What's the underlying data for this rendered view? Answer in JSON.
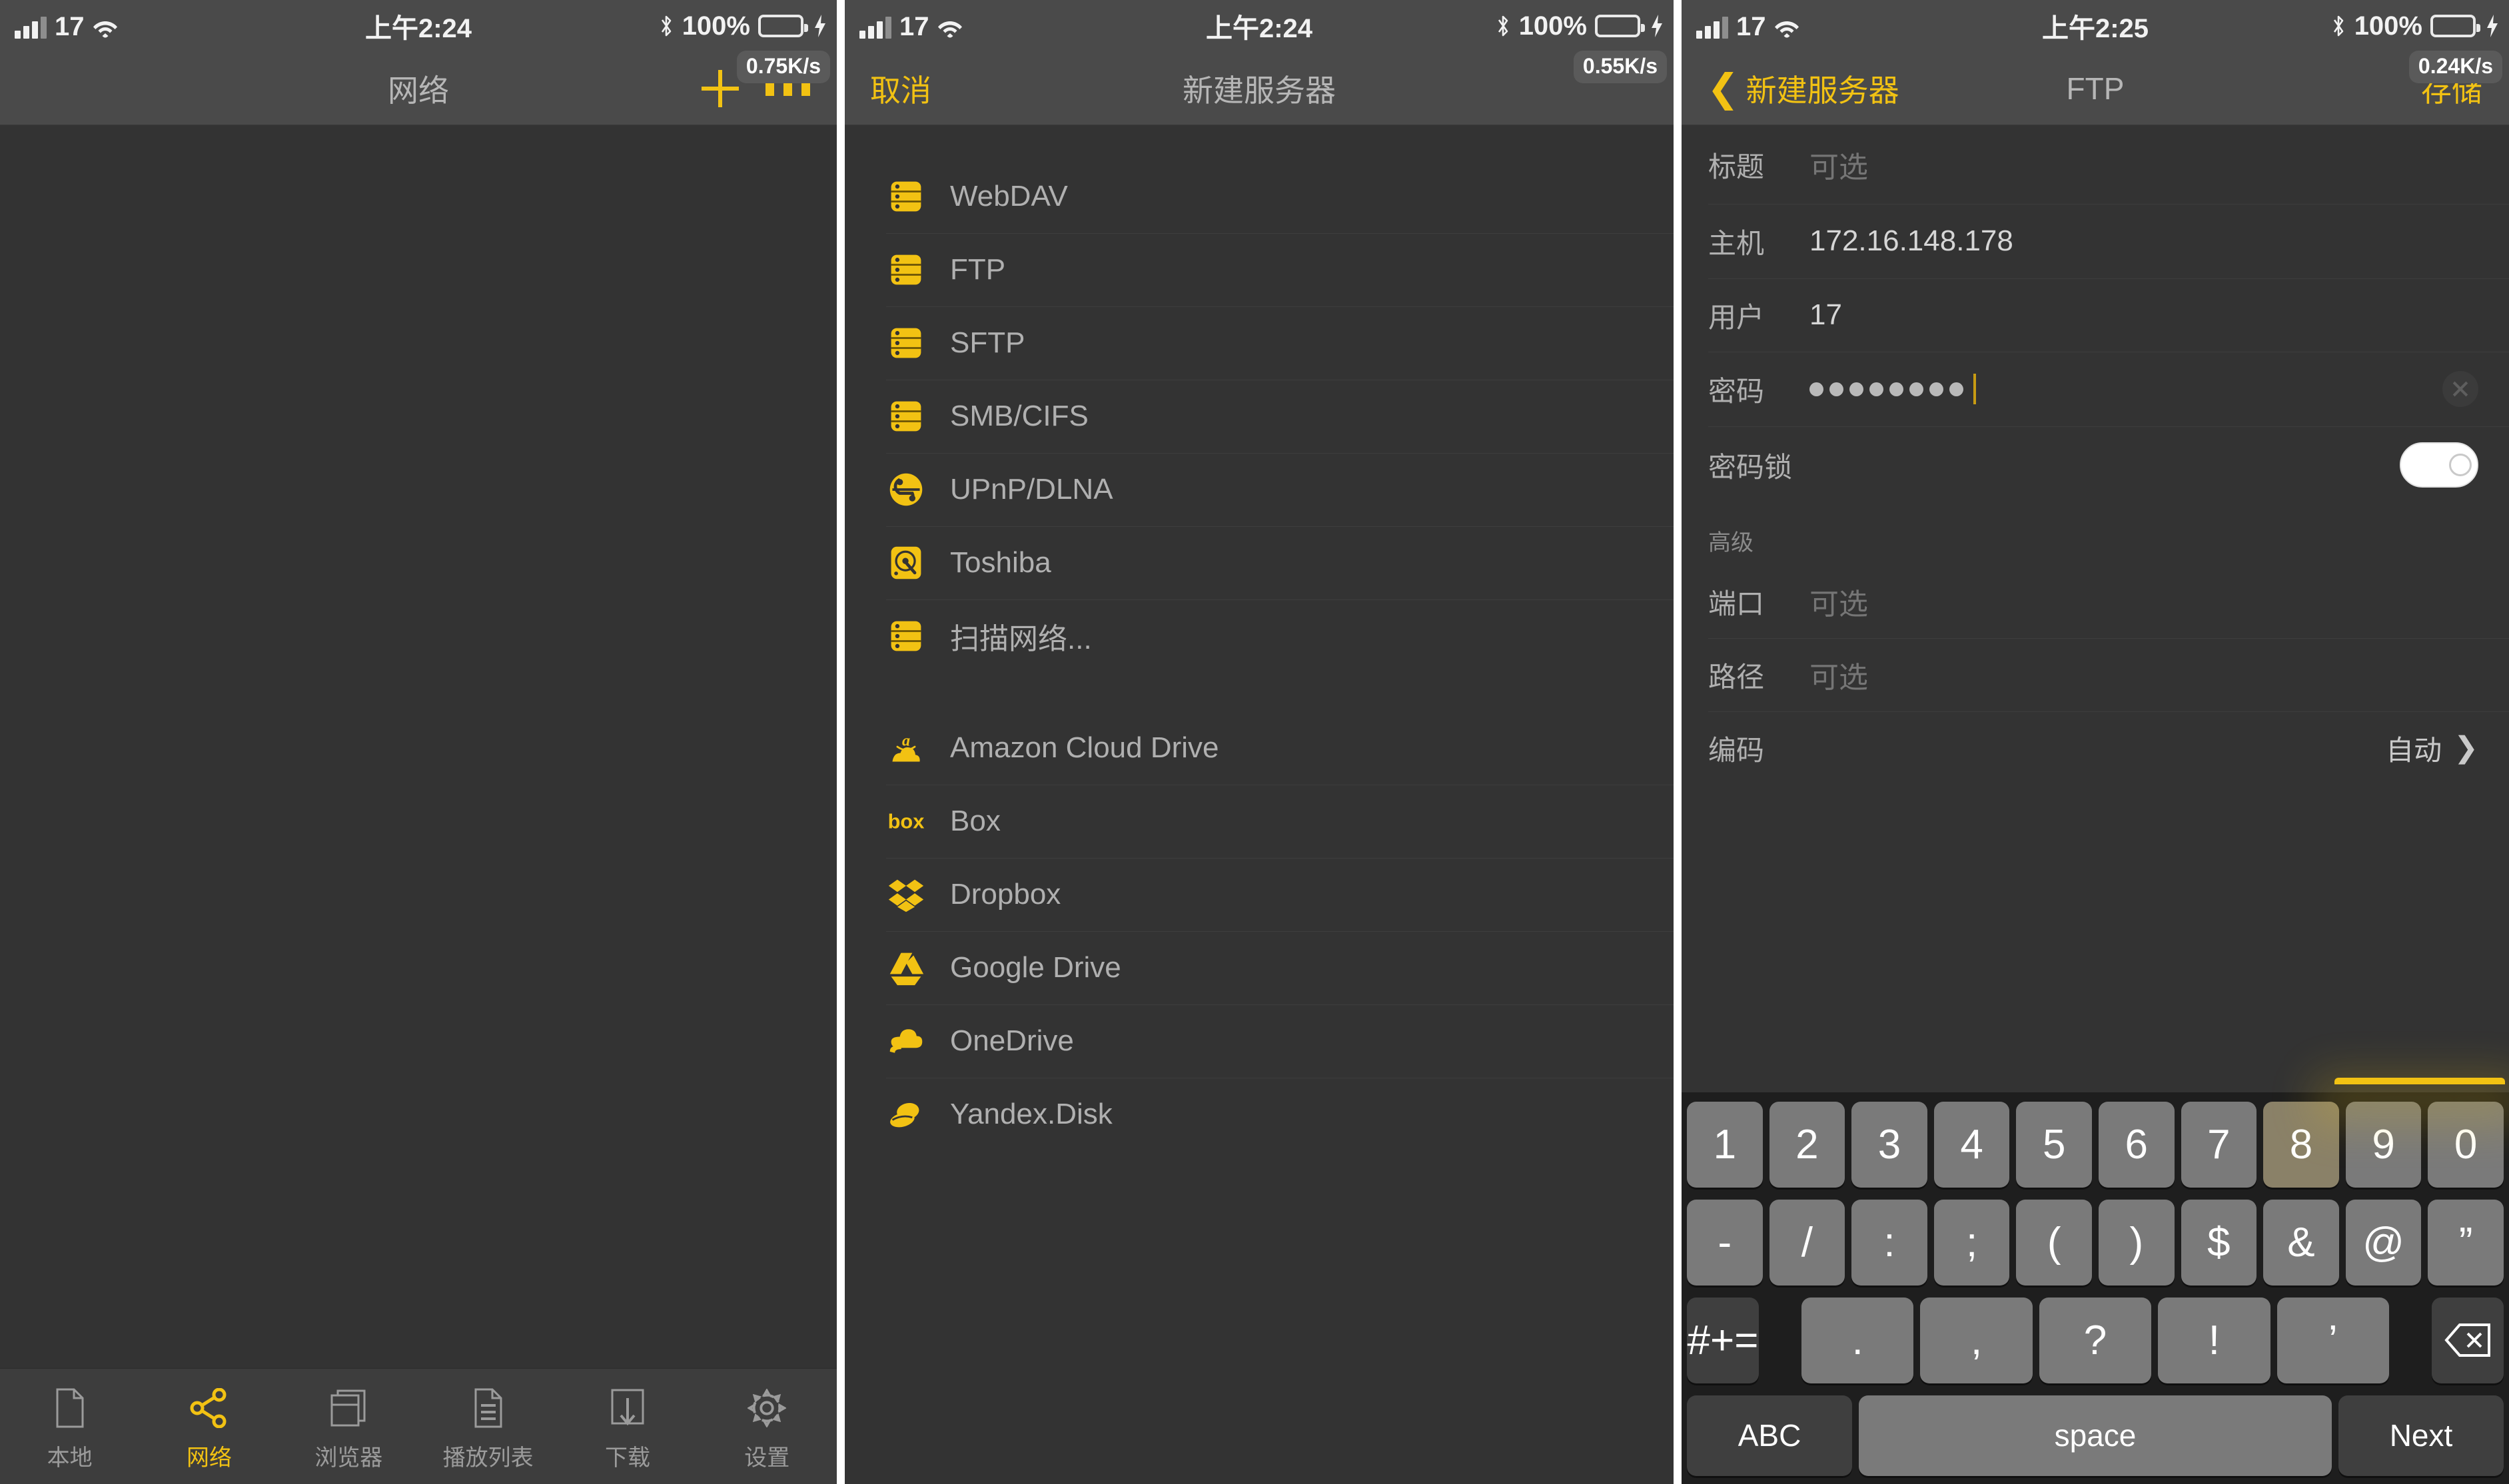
{
  "status_bars": [
    {
      "signal": "signal-bars-icon",
      "carrier": "17",
      "wifi": "wifi-icon",
      "time": "上午2:24",
      "bluetooth": "bluetooth-icon",
      "battery_pct": "100%",
      "charging": true
    },
    {
      "signal": "signal-bars-icon",
      "carrier": "17",
      "wifi": "wifi-icon",
      "time": "上午2:24",
      "bluetooth": "bluetooth-icon",
      "battery_pct": "100%",
      "charging": true
    },
    {
      "signal": "signal-bars-icon",
      "carrier": "17",
      "wifi": "wifi-icon",
      "time": "上午2:25",
      "bluetooth": "bluetooth-icon",
      "battery_pct": "100%",
      "charging": true
    }
  ],
  "colors": {
    "accent": "#f2c213",
    "bg": "#333333",
    "bar_bg": "#4a4a4a",
    "text_primary": "#b6b6b6",
    "text_secondary": "#757575",
    "battery_green": "#4cd964",
    "keyboard_bg": "#1e1e1e",
    "key_bg": "#7a7a7a"
  },
  "panel1": {
    "nav": {
      "title": "网络",
      "add_label": "+",
      "more_label": "···",
      "speed_badge": "0.75K/s"
    },
    "tabs": [
      {
        "label": "本地",
        "icon": "document-icon",
        "active": false
      },
      {
        "label": "网络",
        "icon": "share-network-icon",
        "active": true
      },
      {
        "label": "浏览器",
        "icon": "browser-icon",
        "active": false
      },
      {
        "label": "播放列表",
        "icon": "playlist-icon",
        "active": false
      },
      {
        "label": "下载",
        "icon": "download-icon",
        "active": false
      },
      {
        "label": "设置",
        "icon": "gear-icon",
        "active": false
      }
    ]
  },
  "panel2": {
    "nav": {
      "cancel_label": "取消",
      "title": "新建服务器",
      "speed_badge": "0.55K/s"
    },
    "group1": [
      {
        "label": "WebDAV",
        "icon": "server-icon"
      },
      {
        "label": "FTP",
        "icon": "server-icon"
      },
      {
        "label": "SFTP",
        "icon": "server-icon"
      },
      {
        "label": "SMB/CIFS",
        "icon": "server-icon"
      },
      {
        "label": "UPnP/DLNA",
        "icon": "upnp-icon"
      },
      {
        "label": "Toshiba",
        "icon": "harddisk-icon"
      },
      {
        "label": "扫描网络...",
        "icon": "server-icon"
      }
    ],
    "group2": [
      {
        "label": "Amazon Cloud Drive",
        "icon": "amazon-cloud-drive-icon"
      },
      {
        "label": "Box",
        "icon": "box-icon"
      },
      {
        "label": "Dropbox",
        "icon": "dropbox-icon"
      },
      {
        "label": "Google Drive",
        "icon": "google-drive-icon"
      },
      {
        "label": "OneDrive",
        "icon": "onedrive-icon"
      },
      {
        "label": "Yandex.Disk",
        "icon": "yandex-disk-icon"
      }
    ]
  },
  "panel3": {
    "nav": {
      "back_label": "新建服务器",
      "title": "FTP",
      "save_label": "存储",
      "speed_badge": "0.24K/s"
    },
    "fields": [
      {
        "label": "标题",
        "value": "",
        "placeholder": "可选",
        "type": "text"
      },
      {
        "label": "主机",
        "value": "172.16.148.178",
        "placeholder": "",
        "type": "text"
      },
      {
        "label": "用户",
        "value": "17",
        "placeholder": "",
        "type": "text"
      },
      {
        "label": "密码",
        "value": "••••••••",
        "placeholder": "",
        "type": "password",
        "dot_count": 8,
        "focused": true,
        "clear_icon": "clear-circle-icon"
      },
      {
        "label": "密码锁",
        "value": "off",
        "type": "toggle"
      }
    ],
    "advanced_header": "高级",
    "advanced_fields": [
      {
        "label": "端口",
        "value": "",
        "placeholder": "可选",
        "type": "text"
      },
      {
        "label": "路径",
        "value": "",
        "placeholder": "可选",
        "type": "text"
      },
      {
        "label": "编码",
        "value": "自动",
        "type": "disclosure",
        "chevron": "chevron-right-icon"
      }
    ],
    "keyboard": {
      "row1": [
        "1",
        "2",
        "3",
        "4",
        "5",
        "6",
        "7",
        "8",
        "9",
        "0"
      ],
      "row1_pressed": "8",
      "row2": [
        "-",
        "/",
        ":",
        ";",
        "(",
        ")",
        "$",
        "&",
        "@",
        "”"
      ],
      "row3_symbols": "#+=",
      "row3": [
        ".",
        ",",
        "?",
        "!",
        "’"
      ],
      "row3_backspace": "backspace-icon",
      "row4_abc": "ABC",
      "row4_space": "space",
      "row4_next": "Next"
    }
  }
}
